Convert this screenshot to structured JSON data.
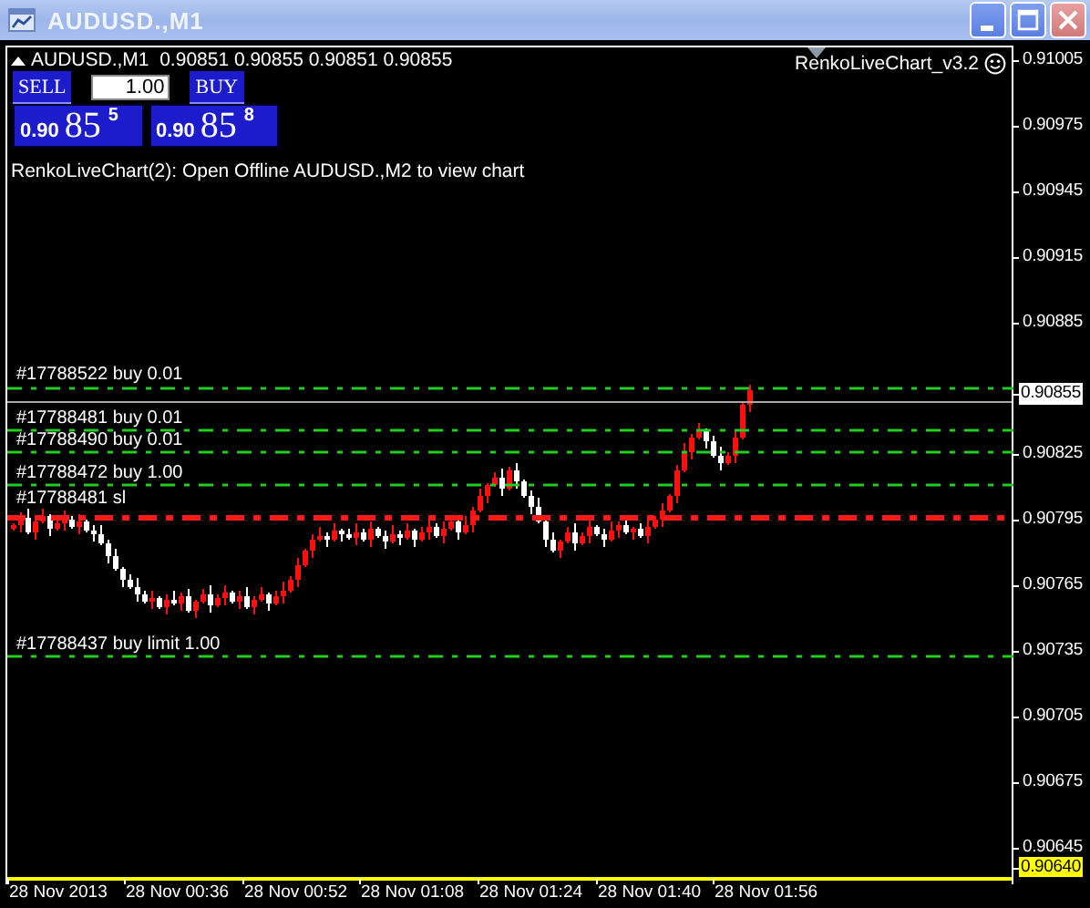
{
  "window": {
    "title": "AUDUSD.,M1"
  },
  "chart_header": "AUDUSD.,M1  0.90851 0.90855 0.90851 0.90855",
  "trade_panel": {
    "sell": {
      "label": "SELL",
      "prefix": "0.90",
      "big": "85",
      "sup": "5"
    },
    "lot": "1.00",
    "buy": {
      "label": "BUY",
      "prefix": "0.90",
      "big": "85",
      "sup": "8"
    }
  },
  "comment": "RenkoLiveChart(2): Open Offline AUDUSD.,M2 to view chart",
  "indicator": "RenkoLiveChart_v3.2",
  "orders": [
    {
      "label": "#17788522 buy 0.01",
      "kind": "order"
    },
    {
      "label": "#17788481 buy 0.01",
      "kind": "order"
    },
    {
      "label": "#17788490 buy 0.01",
      "kind": "order"
    },
    {
      "label": "#17788472 buy 1.00",
      "kind": "order"
    },
    {
      "label": "#17788481 sl",
      "kind": "stop_loss"
    },
    {
      "label": "#17788437 buy limit 1.00",
      "kind": "order"
    }
  ],
  "price_axis": [
    {
      "label": "0.91005",
      "kind": "tick"
    },
    {
      "label": "0.90975",
      "kind": "tick"
    },
    {
      "label": "0.90945",
      "kind": "tick"
    },
    {
      "label": "0.90915",
      "kind": "tick"
    },
    {
      "label": "0.90885",
      "kind": "tick"
    },
    {
      "label": "0.90855",
      "kind": "current"
    },
    {
      "label": "0.90825",
      "kind": "tick"
    },
    {
      "label": "0.90795",
      "kind": "tick"
    },
    {
      "label": "0.90765",
      "kind": "tick"
    },
    {
      "label": "0.90735",
      "kind": "tick"
    },
    {
      "label": "0.90705",
      "kind": "tick"
    },
    {
      "label": "0.90675",
      "kind": "tick"
    },
    {
      "label": "0.90645",
      "kind": "tick"
    },
    {
      "label": "0.90640",
      "kind": "marker"
    }
  ],
  "time_axis": [
    "28 Nov 2013",
    "28 Nov 00:36",
    "28 Nov 00:52",
    "28 Nov 01:08",
    "28 Nov 01:24",
    "28 Nov 01:40",
    "28 Nov 01:56"
  ]
}
